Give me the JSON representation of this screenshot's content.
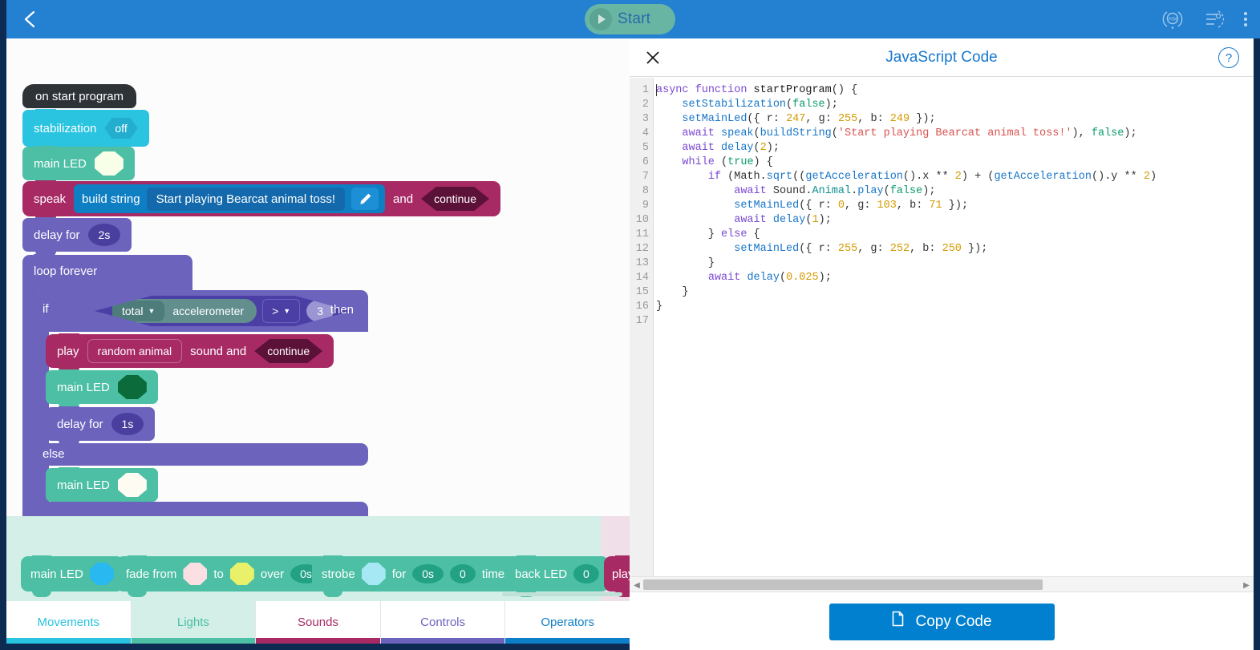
{
  "topbar": {
    "back_icon": "arrow-left-icon",
    "start_label": "Start",
    "icons": [
      "aim-icon",
      "sensor-tuning-icon",
      "overflow-menu-icon"
    ],
    "accent": "#2480d0"
  },
  "canvas": {
    "blocks": {
      "hat": "on start program",
      "stabilization": {
        "label": "stabilization",
        "value": "off"
      },
      "main_led_1": {
        "label": "main LED",
        "color": "#f7ffe9"
      },
      "speak": {
        "label": "speak",
        "build_string": "build string",
        "text": "Start playing Bearcat animal toss!",
        "edit_icon": "pencil-icon",
        "and": "and",
        "mode": "continue"
      },
      "delay_1": {
        "label": "delay for",
        "value": "2s"
      },
      "loop": "loop forever",
      "if": {
        "if_label": "if",
        "metric": "total",
        "sensor": "accelerometer",
        "operator": ">",
        "threshold": "3",
        "then_label": "then"
      },
      "play_sound": {
        "label": "play",
        "sound": "random animal",
        "mid": "sound and",
        "mode": "continue"
      },
      "main_led_2": {
        "label": "main LED",
        "color": "#0b6b3a"
      },
      "delay_2": {
        "label": "delay for",
        "value": "1s"
      },
      "else_label": "else",
      "main_led_3": {
        "label": "main LED",
        "color": "#fdfbf2"
      },
      "loop_return_icon": "loop-arrow-icon"
    }
  },
  "palette": {
    "blocks": [
      {
        "name": "main-led",
        "parts": [
          "main LED"
        ],
        "swatch": "#29b8ef"
      },
      {
        "name": "fade",
        "parts": [
          "fade from",
          "to",
          "over"
        ],
        "from": "#fbdfe2",
        "to": "#e9f06a",
        "duration": "0s"
      },
      {
        "name": "strobe",
        "parts": [
          "strobe",
          "for",
          "times"
        ],
        "swatch": "#a7e8f5",
        "duration": "0s",
        "count": "0"
      },
      {
        "name": "back-led",
        "parts": [
          "back LED"
        ],
        "value": "0"
      },
      {
        "name": "play",
        "parts": [
          "play"
        ]
      }
    ]
  },
  "tabs": [
    {
      "label": "Movements",
      "color": "#29c3e0",
      "active": false
    },
    {
      "label": "Lights",
      "color": "#4cbfa4",
      "active": true
    },
    {
      "label": "Sounds",
      "color": "#a72a64",
      "active": false
    },
    {
      "label": "Controls",
      "color": "#6c63bd",
      "active": false
    },
    {
      "label": "Operators",
      "color": "#0d7ec8",
      "active": false
    }
  ],
  "code_panel": {
    "title": "JavaScript Code",
    "close_icon": "close-icon",
    "help_icon": "help-icon",
    "copy_label": "Copy Code",
    "copy_icon": "copy-icon",
    "line_numbers": [
      "1",
      "2",
      "3",
      "4",
      "5",
      "6",
      "7",
      "8",
      "9",
      "10",
      "11",
      "12",
      "13",
      "14",
      "15",
      "16",
      "17"
    ],
    "code_lines": [
      "async function startProgram() {",
      "    setStabilization(false);",
      "    setMainLed({ r: 247, g: 255, b: 249 });",
      "    await speak(buildString('Start playing Bearcat animal toss!'), false);",
      "    await delay(2);",
      "    while (true) {",
      "        if (Math.sqrt((getAcceleration().x ** 2) + (getAcceleration().y ** 2)",
      "            await Sound.Animal.play(false);",
      "            setMainLed({ r: 0, g: 103, b: 71 });",
      "            await delay(1);",
      "        } else {",
      "            setMainLed({ r: 255, g: 252, b: 250 });",
      "        }",
      "        await delay(0.025);",
      "    }",
      "}",
      ""
    ]
  }
}
